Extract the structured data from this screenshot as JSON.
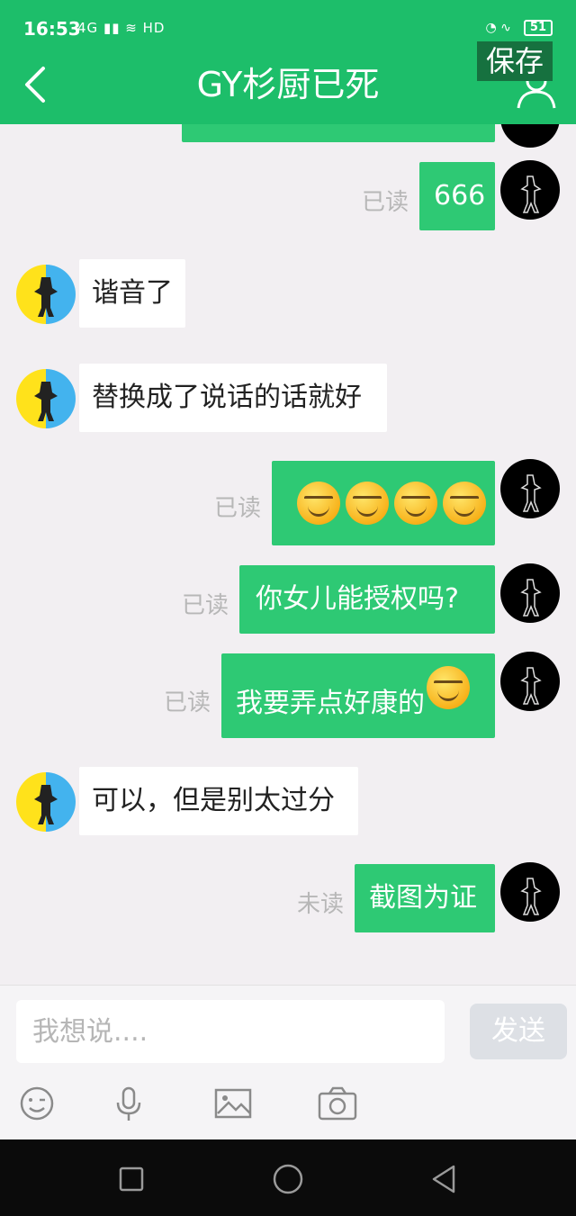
{
  "status_bar": {
    "time": "16:53",
    "signal": "4G",
    "hd": "HD",
    "battery": "51"
  },
  "header": {
    "title": "GY杉厨已死",
    "overlay_label": "保存"
  },
  "messages": [
    {
      "side": "out",
      "text": "666",
      "status": "已读"
    },
    {
      "side": "in",
      "text": "谐音了"
    },
    {
      "side": "in",
      "text": "替换成了说话的话就好"
    },
    {
      "side": "out",
      "text": "",
      "emoji_count": 4,
      "status": "已读"
    },
    {
      "side": "out",
      "text": "你女儿能授权吗?",
      "status": "已读"
    },
    {
      "side": "out",
      "text": "我要弄点好康的",
      "trailing_emoji": true,
      "status": "已读"
    },
    {
      "side": "in",
      "text": "可以，但是别太过分"
    },
    {
      "side": "out",
      "text": "截图为证",
      "status": "未读"
    }
  ],
  "composer": {
    "placeholder": "我想说....",
    "send_label": "发送"
  },
  "toolbar_icons": [
    "emoji-icon",
    "microphone-icon",
    "image-icon",
    "camera-icon"
  ],
  "colors": {
    "header": "#1dbe6a",
    "outgoing_bubble": "#2ec974",
    "incoming_bubble": "#ffffff",
    "background": "#f2eff2"
  }
}
